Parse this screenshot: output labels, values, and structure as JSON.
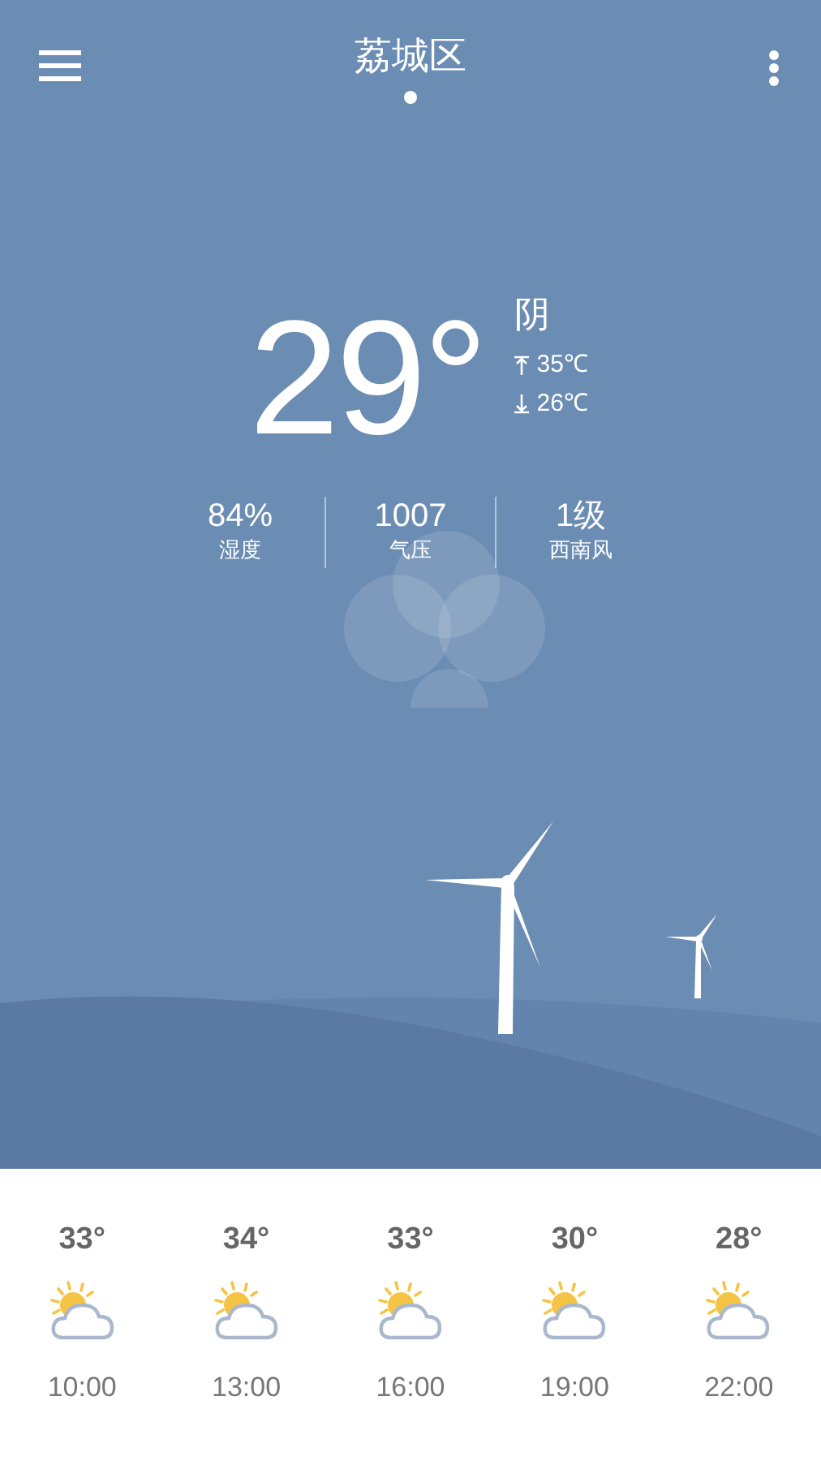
{
  "header": {
    "city": "荔城区",
    "pages": [
      {
        "selected": true
      }
    ]
  },
  "current": {
    "temperature": "29°",
    "condition": "阴",
    "high": "35℃",
    "low": "26℃"
  },
  "stats": [
    {
      "value": "84%",
      "label": "湿度"
    },
    {
      "value": "1007",
      "label": "气压"
    },
    {
      "value": "1级",
      "label": "西南风"
    }
  ],
  "hourly": [
    {
      "temperature": "33°",
      "time": "10:00"
    },
    {
      "temperature": "34°",
      "time": "13:00"
    },
    {
      "temperature": "33°",
      "time": "16:00"
    },
    {
      "temperature": "30°",
      "time": "19:00"
    },
    {
      "temperature": "28°",
      "time": "22:00"
    }
  ]
}
